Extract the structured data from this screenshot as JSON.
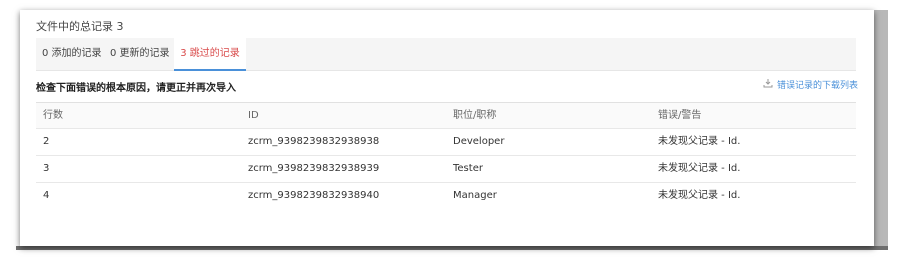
{
  "summary": {
    "label": "文件中的总记录",
    "count": "3"
  },
  "tabs": [
    {
      "label": "0 添加的记录",
      "active": false
    },
    {
      "label": "0 更新的记录",
      "active": false
    },
    {
      "label": "3 跳过的记录",
      "active": true
    }
  ],
  "hint": "检查下面错误的根本原因，请更正并再次导入",
  "download": {
    "label": "错误记录的下载列表",
    "icon": "download-icon"
  },
  "table": {
    "columns": [
      "行数",
      "ID",
      "职位/职称",
      "错误/警告"
    ],
    "rows": [
      [
        "2",
        "zcrm_9398239832938938",
        "Developer",
        "未发现父记录 - Id."
      ],
      [
        "3",
        "zcrm_9398239832938939",
        "Tester",
        "未发现父记录 - Id."
      ],
      [
        "4",
        "zcrm_9398239832938940",
        "Manager",
        "未发现父记录 - Id."
      ]
    ]
  },
  "colors": {
    "active_tab_text": "#d94b4b",
    "active_tab_underline": "#4a90d9",
    "link": "#4a90d9"
  }
}
